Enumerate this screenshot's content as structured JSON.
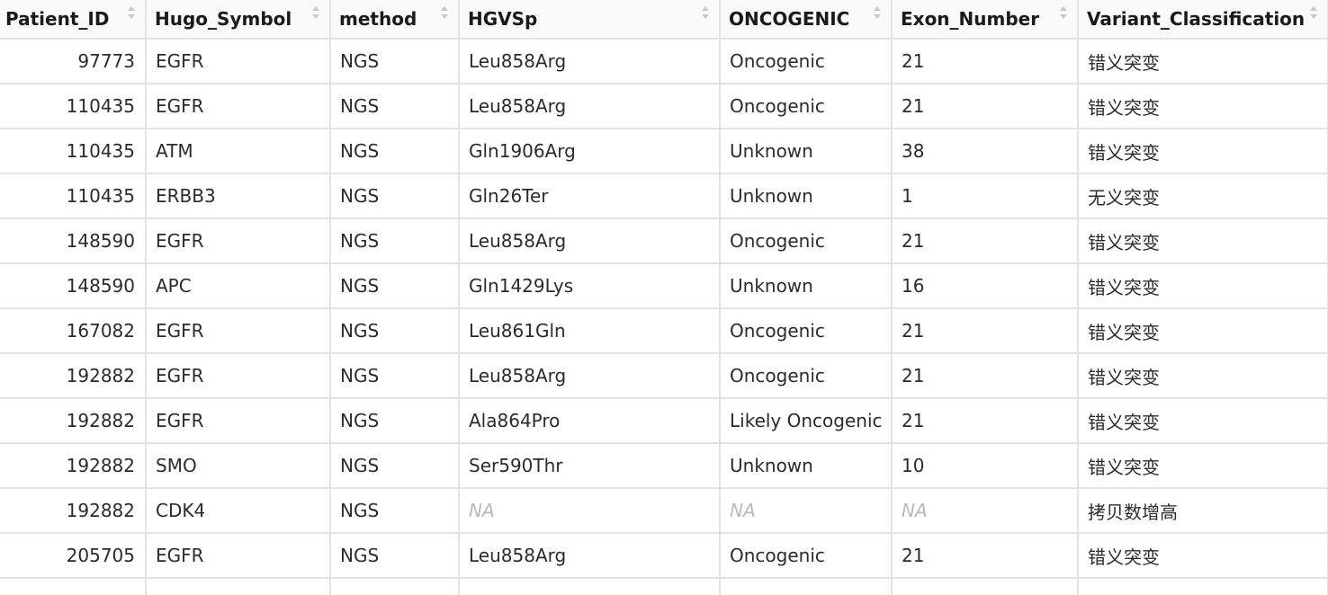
{
  "columns": [
    "Patient_ID",
    "Hugo_Symbol",
    "method",
    "HGVSp",
    "ONCOGENIC",
    "Exon_Number",
    "Variant_Classification"
  ],
  "sort_icon": "sort-arrows-icon",
  "rows": [
    [
      "97773",
      "EGFR",
      "NGS",
      "Leu858Arg",
      "Oncogenic",
      "21",
      "错义突变"
    ],
    [
      "110435",
      "EGFR",
      "NGS",
      "Leu858Arg",
      "Oncogenic",
      "21",
      "错义突变"
    ],
    [
      "110435",
      "ATM",
      "NGS",
      "Gln1906Arg",
      "Unknown",
      "38",
      "错义突变"
    ],
    [
      "110435",
      "ERBB3",
      "NGS",
      "Gln26Ter",
      "Unknown",
      "1",
      "无义突变"
    ],
    [
      "148590",
      "EGFR",
      "NGS",
      "Leu858Arg",
      "Oncogenic",
      "21",
      "错义突变"
    ],
    [
      "148590",
      "APC",
      "NGS",
      "Gln1429Lys",
      "Unknown",
      "16",
      "错义突变"
    ],
    [
      "167082",
      "EGFR",
      "NGS",
      "Leu861Gln",
      "Oncogenic",
      "21",
      "错义突变"
    ],
    [
      "192882",
      "EGFR",
      "NGS",
      "Leu858Arg",
      "Oncogenic",
      "21",
      "错义突变"
    ],
    [
      "192882",
      "EGFR",
      "NGS",
      "Ala864Pro",
      "Likely Oncogenic",
      "21",
      "错义突变"
    ],
    [
      "192882",
      "SMO",
      "NGS",
      "Ser590Thr",
      "Unknown",
      "10",
      "错义突变"
    ],
    [
      "192882",
      "CDK4",
      "NGS",
      "NA",
      "NA",
      "NA",
      "拷贝数增高"
    ],
    [
      "205705",
      "EGFR",
      "NGS",
      "Leu858Arg",
      "Oncogenic",
      "21",
      "错义突变"
    ]
  ],
  "colors": {
    "header_bg": "#f9f9fb",
    "grid_line": "#e2e3e6",
    "na_text": "#b9b9b9"
  }
}
